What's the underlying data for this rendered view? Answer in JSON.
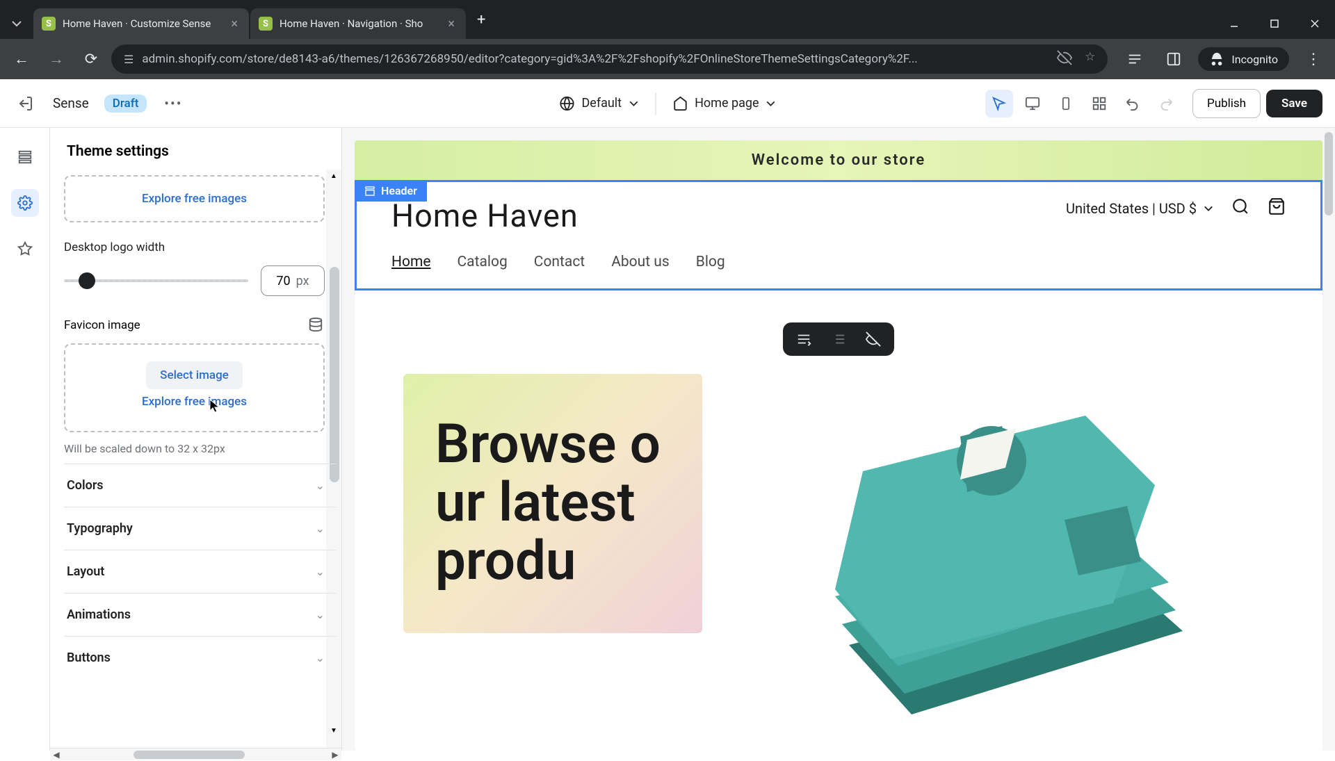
{
  "browser": {
    "tabs": [
      {
        "title": "Home Haven · Customize Sense"
      },
      {
        "title": "Home Haven · Navigation · Sho"
      }
    ],
    "url": "admin.shopify.com/store/de8143-a6/themes/126367268950/editor?category=gid%3A%2F%2Fshopify%2FOnlineStoreThemeSettingsCategory%2F...",
    "incognito_label": "Incognito"
  },
  "appbar": {
    "theme_name": "Sense",
    "status": "Draft",
    "default_label": "Default",
    "page_label": "Home page",
    "publish": "Publish",
    "save": "Save"
  },
  "sidebar": {
    "title": "Theme settings",
    "explore_images": "Explore free images",
    "desktop_logo_width_label": "Desktop logo width",
    "desktop_logo_width_value": "70",
    "desktop_logo_width_unit": "px",
    "favicon_label": "Favicon image",
    "select_image": "Select image",
    "favicon_hint": "Will be scaled down to 32 x 32px",
    "accordion": {
      "colors": "Colors",
      "typography": "Typography",
      "layout": "Layout",
      "animations": "Animations",
      "buttons": "Buttons"
    }
  },
  "preview": {
    "announcement": "Welcome to our store",
    "header_tag": "Header",
    "store_name": "Home Haven",
    "locale": "United States | USD $",
    "nav": {
      "home": "Home",
      "catalog": "Catalog",
      "contact": "Contact",
      "about": "About us",
      "blog": "Blog"
    },
    "hero_text": "Browse our latest produ"
  }
}
